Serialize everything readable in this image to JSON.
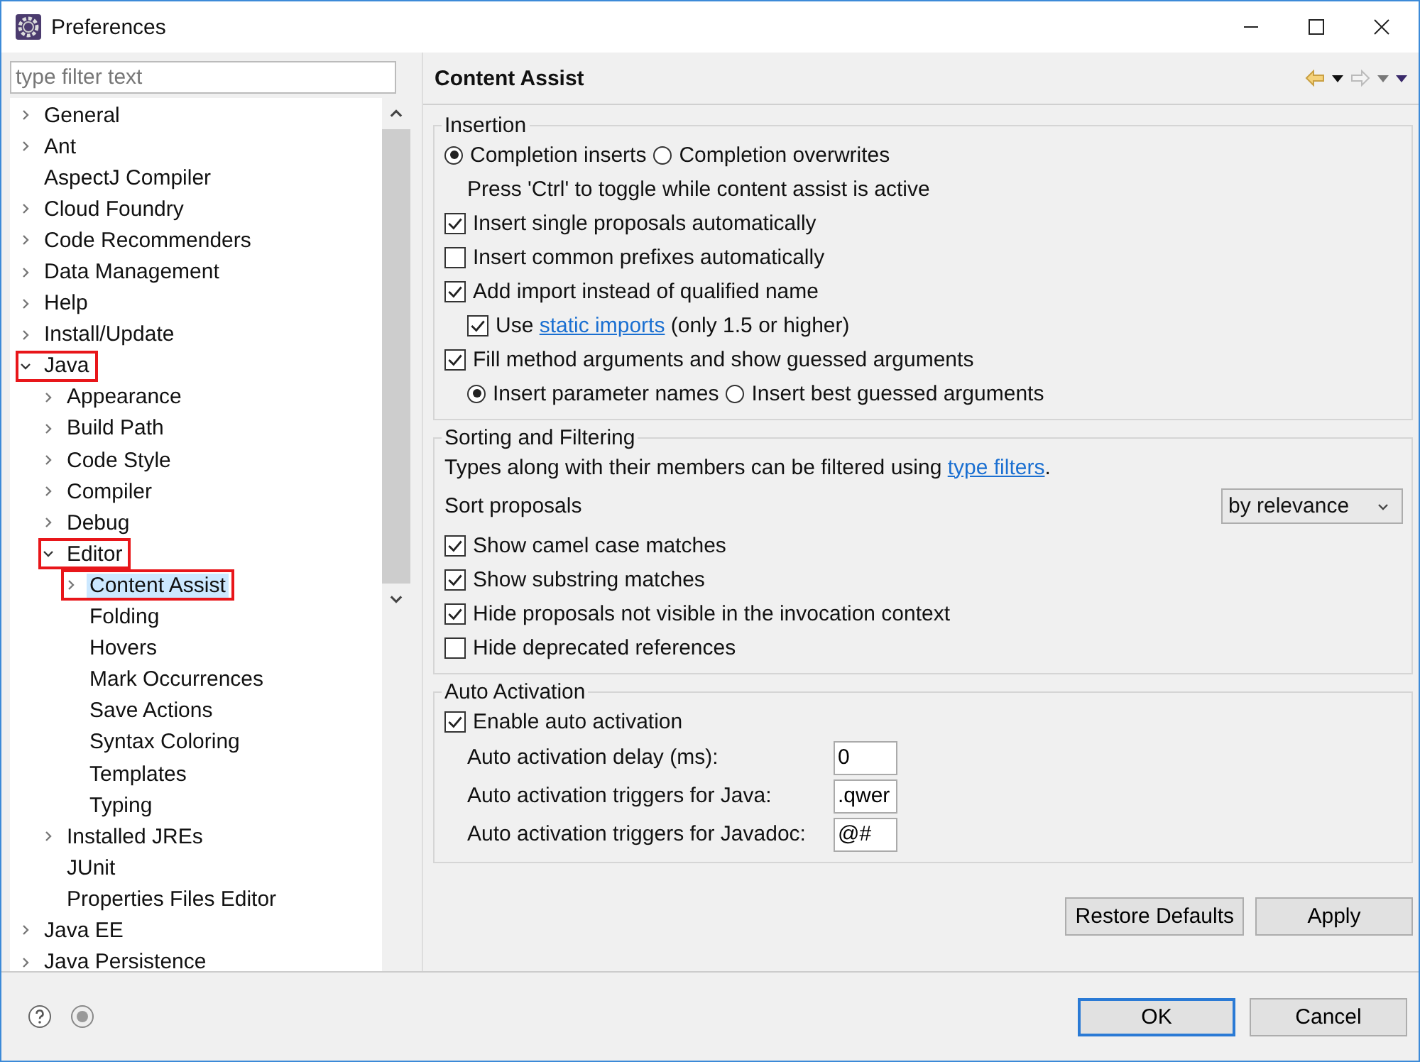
{
  "window": {
    "title": "Preferences"
  },
  "filter": {
    "placeholder": "type filter text"
  },
  "tree": [
    {
      "label": "General",
      "expandable": true,
      "expanded": false,
      "selected": false,
      "highlighted": false
    },
    {
      "label": "Ant",
      "expandable": true,
      "expanded": false,
      "selected": false,
      "highlighted": false
    },
    {
      "label": "AspectJ Compiler",
      "expandable": false,
      "selected": false,
      "highlighted": false
    },
    {
      "label": "Cloud Foundry",
      "expandable": true,
      "expanded": false,
      "selected": false,
      "highlighted": false
    },
    {
      "label": "Code Recommenders",
      "expandable": true,
      "expanded": false,
      "selected": false,
      "highlighted": false
    },
    {
      "label": "Data Management",
      "expandable": true,
      "expanded": false,
      "selected": false,
      "highlighted": false
    },
    {
      "label": "Help",
      "expandable": true,
      "expanded": false,
      "selected": false,
      "highlighted": false
    },
    {
      "label": "Install/Update",
      "expandable": true,
      "expanded": false,
      "selected": false,
      "highlighted": false
    },
    {
      "label": "Java",
      "expandable": true,
      "expanded": true,
      "selected": false,
      "highlighted": true,
      "children": [
        {
          "label": "Appearance",
          "expandable": true,
          "expanded": false,
          "selected": false,
          "highlighted": false
        },
        {
          "label": "Build Path",
          "expandable": true,
          "expanded": false,
          "selected": false,
          "highlighted": false
        },
        {
          "label": "Code Style",
          "expandable": true,
          "expanded": false,
          "selected": false,
          "highlighted": false
        },
        {
          "label": "Compiler",
          "expandable": true,
          "expanded": false,
          "selected": false,
          "highlighted": false
        },
        {
          "label": "Debug",
          "expandable": true,
          "expanded": false,
          "selected": false,
          "highlighted": false
        },
        {
          "label": "Editor",
          "expandable": true,
          "expanded": true,
          "selected": false,
          "highlighted": true,
          "children": [
            {
              "label": "Content Assist",
              "expandable": true,
              "expanded": false,
              "selected": true,
              "highlighted": true
            },
            {
              "label": "Folding",
              "expandable": false,
              "selected": false,
              "highlighted": false
            },
            {
              "label": "Hovers",
              "expandable": false,
              "selected": false,
              "highlighted": false
            },
            {
              "label": "Mark Occurrences",
              "expandable": false,
              "selected": false,
              "highlighted": false
            },
            {
              "label": "Save Actions",
              "expandable": false,
              "selected": false,
              "highlighted": false
            },
            {
              "label": "Syntax Coloring",
              "expandable": false,
              "selected": false,
              "highlighted": false
            },
            {
              "label": "Templates",
              "expandable": false,
              "selected": false,
              "highlighted": false
            },
            {
              "label": "Typing",
              "expandable": false,
              "selected": false,
              "highlighted": false
            }
          ]
        },
        {
          "label": "Installed JREs",
          "expandable": true,
          "expanded": false,
          "selected": false,
          "highlighted": false
        },
        {
          "label": "JUnit",
          "expandable": false,
          "selected": false,
          "highlighted": false
        },
        {
          "label": "Properties Files Editor",
          "expandable": false,
          "selected": false,
          "highlighted": false
        }
      ]
    },
    {
      "label": "Java EE",
      "expandable": true,
      "expanded": false,
      "selected": false,
      "highlighted": false
    },
    {
      "label": "Java Persistence",
      "expandable": true,
      "expanded": false,
      "selected": false,
      "highlighted": false
    }
  ],
  "page": {
    "title": "Content Assist"
  },
  "insertion": {
    "title": "Insertion",
    "radios": [
      {
        "label": "Completion inserts",
        "selected": true
      },
      {
        "label": "Completion overwrites",
        "selected": false
      }
    ],
    "hint": "Press 'Ctrl' to toggle while content assist is active",
    "options": [
      {
        "kind": "checkbox",
        "label": "Insert single proposals automatically",
        "checked": true
      },
      {
        "kind": "checkbox",
        "label": "Insert common prefixes automatically",
        "checked": false
      },
      {
        "kind": "checkbox",
        "label": "Add import instead of qualified name",
        "checked": true,
        "children": [
          {
            "kind": "checkbox",
            "parts": [
              {
                "kind": "text",
                "text": "Use "
              },
              {
                "kind": "link",
                "text": "static imports"
              },
              {
                "kind": "text",
                "text": " (only 1.5 or higher)"
              }
            ],
            "checked": true
          }
        ]
      },
      {
        "kind": "checkbox",
        "label": "Fill method arguments and show guessed arguments",
        "checked": true,
        "children": [
          {
            "kind": "radios",
            "radios": [
              {
                "label": "Insert parameter names",
                "selected": true
              },
              {
                "label": "Insert best guessed arguments",
                "selected": false
              }
            ]
          }
        ]
      }
    ]
  },
  "sorting": {
    "title": "Sorting and Filtering",
    "text_parts": [
      {
        "kind": "text",
        "text": "Types along with their members can be filtered using "
      },
      {
        "kind": "link",
        "text": "type filters"
      },
      {
        "kind": "text",
        "text": "."
      }
    ],
    "sort_label": "Sort proposals",
    "sort_value": "by relevance",
    "options": [
      {
        "label": "Show camel case matches",
        "checked": true
      },
      {
        "label": "Show substring matches",
        "checked": true
      },
      {
        "label": "Hide proposals not visible in the invocation context",
        "checked": true
      },
      {
        "label": "Hide deprecated references",
        "checked": false
      }
    ]
  },
  "auto": {
    "title": "Auto Activation",
    "enable": {
      "label": "Enable auto activation",
      "checked": true
    },
    "fields": [
      {
        "label": "Auto activation delay (ms):",
        "value": "0"
      },
      {
        "label": "Auto activation triggers for Java:",
        "value": ".qwer"
      },
      {
        "label": "Auto activation triggers for Javadoc:",
        "value": "@#"
      }
    ]
  },
  "page_buttons": [
    "Restore Defaults",
    "Apply"
  ],
  "dialog_buttons": [
    {
      "label": "OK",
      "default": true
    },
    {
      "label": "Cancel",
      "default": false
    }
  ]
}
